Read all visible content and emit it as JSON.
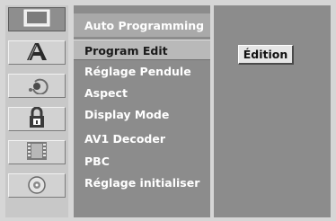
{
  "icons": [
    {
      "name": "tv-icon",
      "selected": true
    },
    {
      "name": "language-a-icon",
      "selected": false
    },
    {
      "name": "audio-icon",
      "selected": false
    },
    {
      "name": "lock-icon",
      "selected": false
    },
    {
      "name": "film-icon",
      "selected": false
    },
    {
      "name": "disc-icon",
      "selected": false
    }
  ],
  "menu": {
    "items": [
      {
        "label": "Auto Programming"
      },
      {
        "label": "Program Edit"
      },
      {
        "label": "Réglage Pendule"
      },
      {
        "label": "Aspect"
      },
      {
        "label": "Display Mode"
      },
      {
        "label": "AV1 Decoder"
      },
      {
        "label": "PBC"
      },
      {
        "label": "Réglage initialiser"
      }
    ],
    "selected_label": "Program Edit"
  },
  "panel": {
    "button_label": "Édition"
  }
}
